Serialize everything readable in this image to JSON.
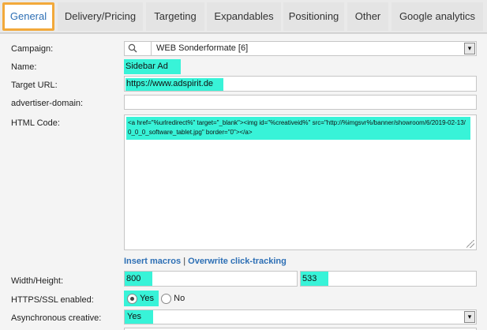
{
  "tabs": [
    {
      "label": "General",
      "active": true
    },
    {
      "label": "Delivery/Pricing",
      "active": false
    },
    {
      "label": "Targeting",
      "active": false
    },
    {
      "label": "Expandables",
      "active": false
    },
    {
      "label": "Positioning",
      "active": false
    },
    {
      "label": "Other",
      "active": false
    },
    {
      "label": "Google analytics",
      "active": false
    }
  ],
  "form": {
    "campaign": {
      "label": "Campaign:",
      "value": "WEB Sonderformate [6]",
      "icon": "search-icon"
    },
    "name": {
      "label": "Name:",
      "value": "Sidebar Ad"
    },
    "target_url": {
      "label": "Target URL:",
      "value": "https://www.adspirit.de"
    },
    "advertiser_domain": {
      "label": "advertiser-domain:",
      "value": ""
    },
    "html_code": {
      "label": "HTML Code:",
      "value": "<a href=\"%urlredirect%\" target=\"_blank\"><img id=\"%creativeid%\" src=\"http://%imgsvr%/banner/showroom/6/2019-02-13/0_0_0_software_tablet.jpg\" border=\"0\"></a>"
    },
    "macros_link": "Insert macros",
    "separator": "|",
    "clicktracking_link": "Overwrite click-tracking",
    "width_height": {
      "label": "Width/Height:",
      "width": "800",
      "height": "533"
    },
    "https": {
      "label": "HTTPS/SSL enabled:",
      "yes_label": "Yes",
      "no_label": "No",
      "selected": "Yes"
    },
    "async": {
      "label": "Asynchronous creative:",
      "value": "Yes"
    }
  },
  "colors": {
    "highlight": "#38f3d8",
    "active_tab_border": "#f2a93b",
    "link": "#2d6fb5"
  }
}
